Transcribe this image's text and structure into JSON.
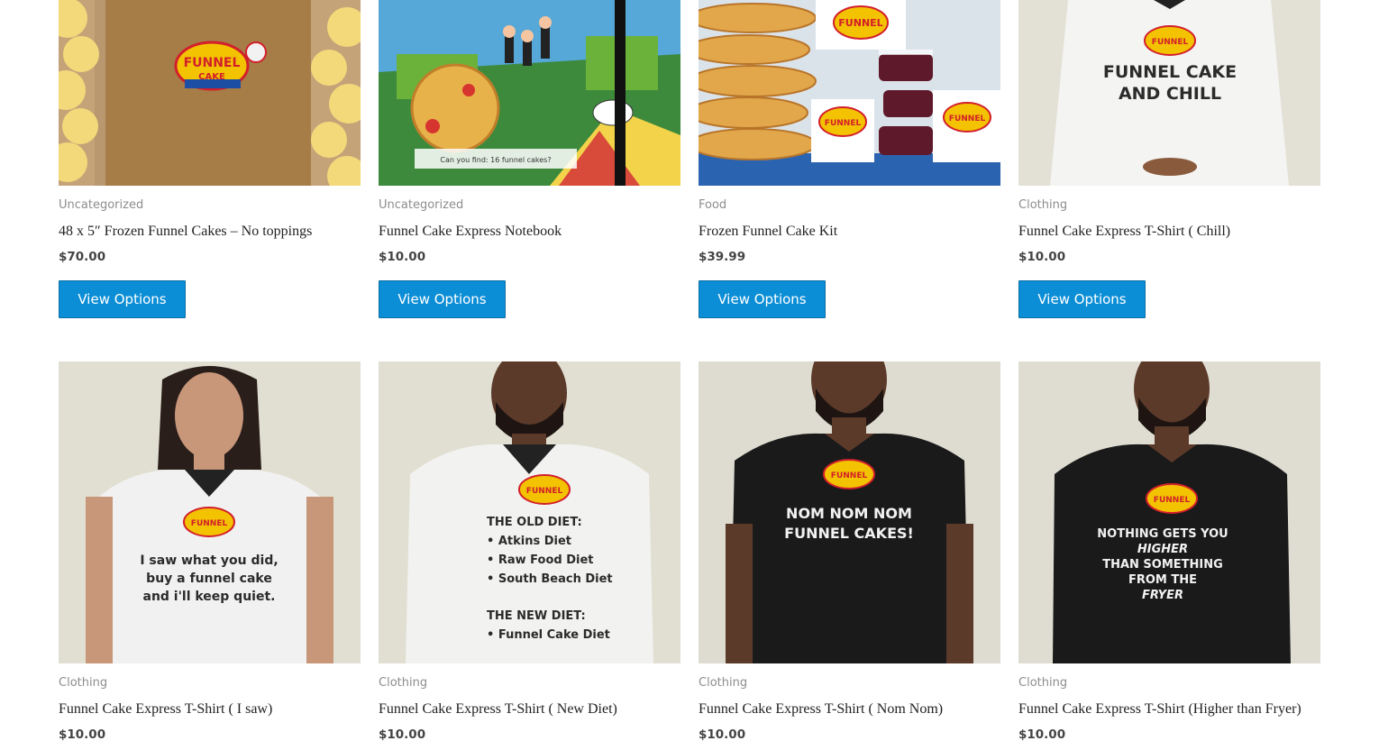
{
  "colors": {
    "button_bg": "#0b8ed6",
    "button_text": "#ffffff",
    "category_text": "#8d8d8d",
    "title_text": "#222222",
    "price_text": "#444444"
  },
  "products": [
    {
      "category": "Uncategorized",
      "title": "48 x 5″ Frozen Funnel Cakes – No toppings",
      "price": "$70.00",
      "button": "View Options"
    },
    {
      "category": "Uncategorized",
      "title": "Funnel Cake Express Notebook",
      "price": "$10.00",
      "button": "View Options"
    },
    {
      "category": "Food",
      "title": "Frozen Funnel Cake Kit",
      "price": "$39.99",
      "button": "View Options"
    },
    {
      "category": "Clothing",
      "title": "Funnel Cake Express T-Shirt ( Chill)",
      "price": "$10.00",
      "button": "View Options",
      "shirt_text": [
        "FUNNEL CAKE",
        "AND CHILL"
      ]
    },
    {
      "category": "Clothing",
      "title": "Funnel Cake Express T-Shirt ( I saw)",
      "price": "$10.00",
      "shirt_text": [
        "I saw what you did,",
        "buy a funnel cake",
        "and i'll keep quiet."
      ]
    },
    {
      "category": "Clothing",
      "title": "Funnel Cake Express T-Shirt ( New Diet)",
      "price": "$10.00",
      "shirt_text": [
        "THE OLD DIET:",
        "• Atkins Diet",
        "• Raw Food Diet",
        "• South Beach Diet",
        "THE NEW DIET:",
        "• Funnel Cake Diet"
      ]
    },
    {
      "category": "Clothing",
      "title": "Funnel Cake Express T-Shirt ( Nom Nom)",
      "price": "$10.00",
      "shirt_text": [
        "NOM NOM NOM",
        "FUNNEL CAKES!"
      ]
    },
    {
      "category": "Clothing",
      "title": "Funnel Cake Express T-Shirt (Higher than Fryer)",
      "price": "$10.00",
      "shirt_text": [
        "NOTHING GETS YOU",
        "HIGHER",
        "THAN SOMETHING",
        "FROM THE",
        "FRYER"
      ]
    }
  ]
}
